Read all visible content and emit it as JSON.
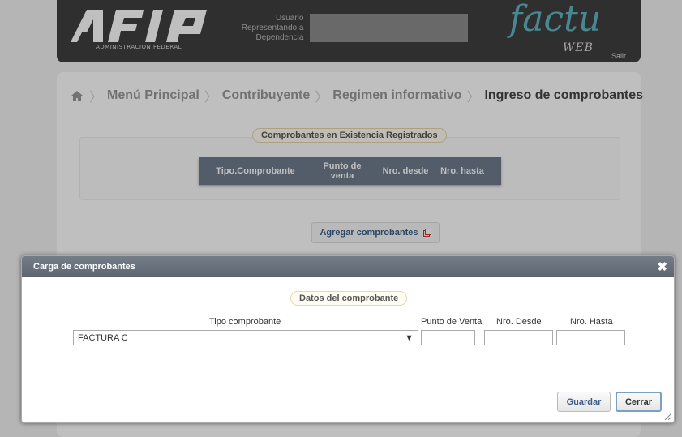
{
  "header": {
    "logo_text": "AFIP",
    "logo_subtitle": "ADMINISTRACION FEDERAL",
    "user_labels": [
      "Usuario :",
      "Representando a :",
      "Dependencia :"
    ],
    "brand": "factu",
    "brand_sub": "WEB",
    "logout": "Salir"
  },
  "breadcrumb": {
    "icon": "home-icon",
    "items": [
      "Menú Principal",
      "Contribuyente",
      "Regimen informativo"
    ],
    "current": "Ingreso de comprobantes"
  },
  "existing": {
    "legend": "Comprobantes en Existencia Registrados",
    "columns": [
      "Tipo.Comprobante",
      "Punto de venta",
      "Nro. desde",
      "Nro. hasta"
    ],
    "add_button": "Agregar comprobantes",
    "add_icon": "external-window-icon"
  },
  "dialog": {
    "title": "Carga de comprobantes",
    "legend": "Datos del comprobante",
    "labels": {
      "tipo": "Tipo comprobante",
      "punto": "Punto de Venta",
      "desde": "Nro. Desde",
      "hasta": "Nro. Hasta"
    },
    "tipo_value": "FACTURA C",
    "punto_value": "",
    "desde_value": "",
    "hasta_value": "",
    "save_label": "Guardar",
    "close_label": "Cerrar"
  }
}
